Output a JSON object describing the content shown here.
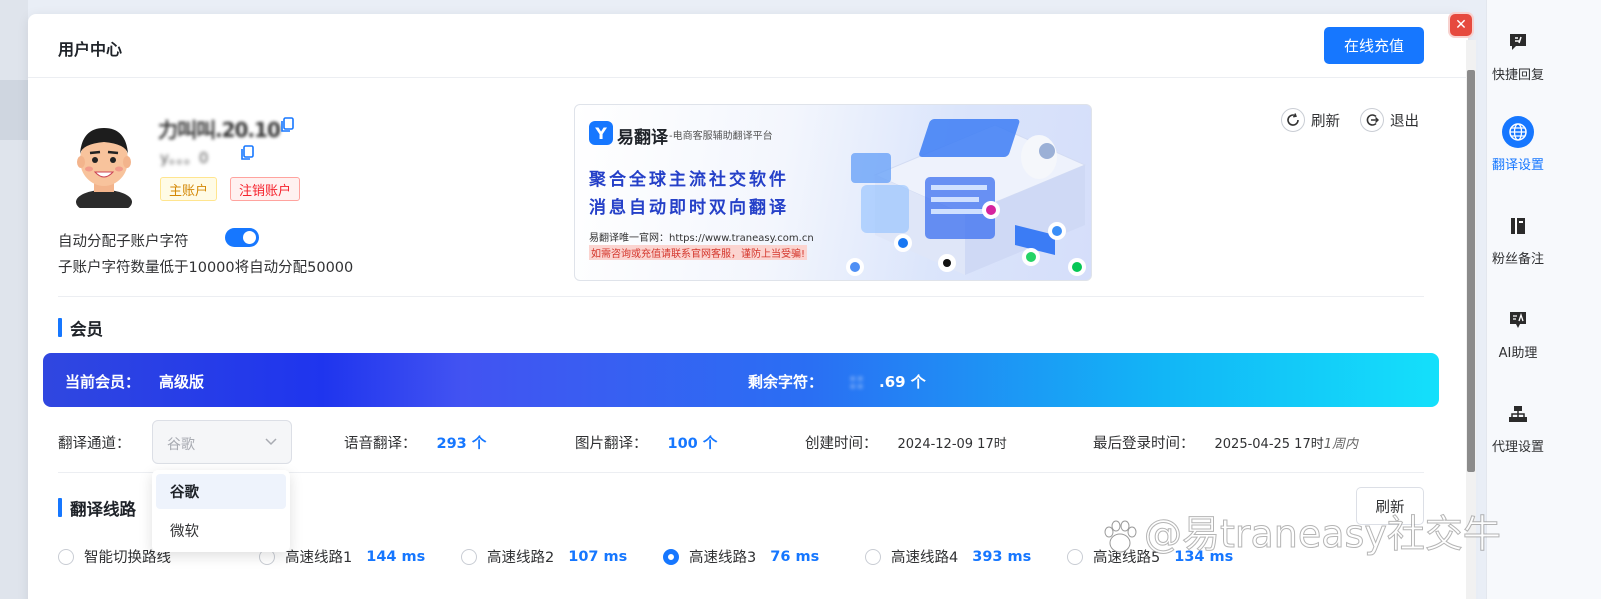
{
  "modal": {
    "title": "用户中心",
    "recharge_label": "在线充值",
    "close_label": "✕"
  },
  "user": {
    "name_masked": "力叫叫.20.10",
    "id_masked": "y。。。0",
    "tag_main": "主账户",
    "tag_cancel": "注销账户",
    "auto_assign_label": "自动分配子账户字符",
    "auto_assign_enabled": true,
    "auto_assign_desc": "子账户字符数量低于10000将自动分配50000"
  },
  "banner": {
    "logo_letter": "Y",
    "brand": "易翻译",
    "tagline": "-电商客服辅助翻译平台",
    "headline1": "聚合全球主流社交软件",
    "headline2": "消息自动即时双向翻译",
    "site_text": "易翻译唯一官网：https://www.traneasy.com.cn",
    "warning": "如需咨询或充值请联系官网客服，谨防上当受骗!"
  },
  "actions": {
    "refresh": "刷新",
    "logout": "退出"
  },
  "member": {
    "section_title": "会员",
    "current_label": "当前会员：",
    "current_value": "高级版",
    "remaining_label": "剩余字符：",
    "remaining_masked": "：：",
    "remaining_value": ".69 个"
  },
  "info": {
    "channel_label": "翻译通道：",
    "channel_value": "谷歌",
    "channel_options": [
      "谷歌",
      "微软"
    ],
    "voice_label": "语音翻译：",
    "voice_value": "293 个",
    "image_label": "图片翻译：",
    "image_value": "100 个",
    "created_label": "创建时间：",
    "created_value": "2024-12-09 17时",
    "last_login_label": "最后登录时间：",
    "last_login_value": "2025-04-25 17时",
    "last_login_ago": "1周内"
  },
  "routes": {
    "section_title": "翻译线路",
    "refresh_label": "刷新",
    "items": [
      {
        "name": "智能切换路线",
        "ms": "",
        "selected": false
      },
      {
        "name": "高速线路1",
        "ms": "144 ms",
        "selected": false
      },
      {
        "name": "高速线路2",
        "ms": "107 ms",
        "selected": false
      },
      {
        "name": "高速线路3",
        "ms": "76 ms",
        "selected": true
      },
      {
        "name": "高速线路4",
        "ms": "393 ms",
        "selected": false
      },
      {
        "name": "高速线路5",
        "ms": "134 ms",
        "selected": false
      }
    ]
  },
  "sidebar": {
    "items": [
      {
        "label": "快捷回复",
        "icon": "quick-reply-icon"
      },
      {
        "label": "翻译设置",
        "icon": "globe-icon",
        "active": true
      },
      {
        "label": "粉丝备注",
        "icon": "notebook-icon"
      },
      {
        "label": "AI助理",
        "icon": "ai-assistant-icon"
      },
      {
        "label": "代理设置",
        "icon": "network-icon"
      }
    ]
  },
  "watermark": "@易traneasy社交牛",
  "colors": {
    "primary": "#1677ff",
    "danger": "#e64a3e",
    "tag_main": "#d48806",
    "tag_cancel": "#f5222d"
  }
}
